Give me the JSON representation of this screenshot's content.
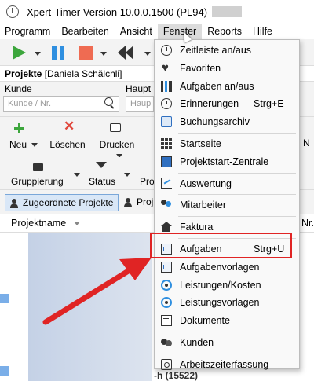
{
  "window": {
    "title": "Xpert-Timer Version 10.0.0.1500 (PL94)"
  },
  "menubar": {
    "items": [
      "Programm",
      "Bearbeiten",
      "Ansicht",
      "Fenster",
      "Reports",
      "Hilfe"
    ],
    "active_index": 3
  },
  "panel": {
    "title": "Projekte",
    "user": "[Daniela Schälchli]"
  },
  "filters": {
    "kunde_label": "Kunde",
    "kunde_placeholder": "Kunde / Nr.",
    "haupt_label": "Haupt",
    "haupt_placeholder": "Haup"
  },
  "actions": {
    "neu": "Neu",
    "loeschen": "Löschen",
    "drucken": "Drucken",
    "overflow_n": "N"
  },
  "grouping": {
    "gruppierung": "Gruppierung",
    "status": "Status",
    "pro": "Pro"
  },
  "tabs": {
    "zugeordnete": "Zugeordnete Projekte",
    "proj": "Proj"
  },
  "grid": {
    "column_projektname": "Projektname",
    "column_nr": "Nr.",
    "partial_row": "-h (15522)"
  },
  "dropdown": {
    "items": [
      {
        "label": "Zeitleiste an/aus",
        "icon": "clock-icon",
        "shortcut": ""
      },
      {
        "label": "Favoriten",
        "icon": "heart-icon",
        "shortcut": ""
      },
      {
        "label": "Aufgaben an/aus",
        "icon": "bars-icon",
        "shortcut": ""
      },
      {
        "label": "Erinnerungen",
        "icon": "alarm-icon",
        "shortcut": "Strg+E"
      },
      {
        "label": "Buchungsarchiv",
        "icon": "archive-icon",
        "shortcut": ""
      },
      {
        "sep": true
      },
      {
        "label": "Startseite",
        "icon": "grid-icon",
        "shortcut": ""
      },
      {
        "label": "Projektstart-Zentrale",
        "icon": "screen-icon",
        "shortcut": ""
      },
      {
        "sep": true
      },
      {
        "label": "Auswertung",
        "icon": "chart-icon",
        "shortcut": ""
      },
      {
        "sep": true
      },
      {
        "label": "Mitarbeiter",
        "icon": "people-icon",
        "shortcut": ""
      },
      {
        "sep": true
      },
      {
        "label": "Faktura",
        "icon": "house-icon",
        "shortcut": ""
      },
      {
        "sep": true
      },
      {
        "label": "Aufgaben",
        "icon": "task-icon",
        "shortcut": "Strg+U"
      },
      {
        "label": "Aufgabenvorlagen",
        "icon": "task-template-icon",
        "shortcut": ""
      },
      {
        "label": "Leistungen/Kosten",
        "icon": "coins-icon",
        "shortcut": ""
      },
      {
        "label": "Leistungsvorlagen",
        "icon": "coins-template-icon",
        "shortcut": ""
      },
      {
        "label": "Dokumente",
        "icon": "document-icon",
        "shortcut": ""
      },
      {
        "sep": true
      },
      {
        "label": "Kunden",
        "icon": "customers-icon",
        "shortcut": ""
      },
      {
        "sep": true
      },
      {
        "label": "Arbeitszeiterfassung",
        "icon": "timer-icon",
        "shortcut": ""
      }
    ]
  },
  "colors": {
    "highlight": "#e02424",
    "play": "#3ca63c",
    "pause": "#2f8fe0",
    "stop": "#ef6b52",
    "selection": "#7aaee8"
  }
}
